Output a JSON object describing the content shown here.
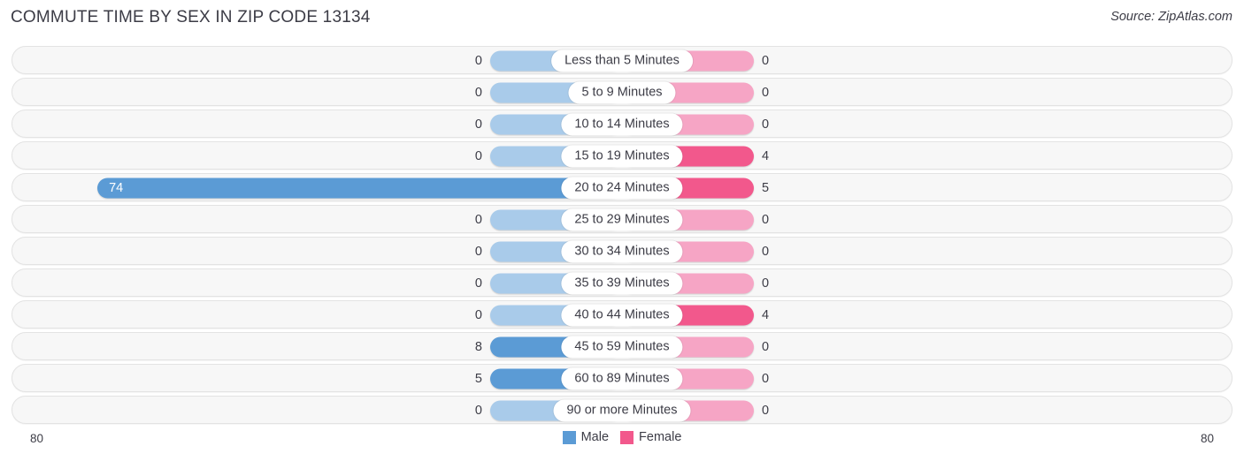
{
  "header": {
    "title": "COMMUTE TIME BY SEX IN ZIP CODE 13134",
    "source": "Source: ZipAtlas.com"
  },
  "axis": {
    "left_label": "80",
    "right_label": "80"
  },
  "legend": {
    "items": [
      {
        "label": "Male",
        "color": "#5b9bd5"
      },
      {
        "label": "Female",
        "color": "#f2588c"
      }
    ]
  },
  "colors": {
    "male_light": "#a9cbea",
    "male_strong": "#5b9bd5",
    "female_light": "#f6a5c5",
    "female_strong": "#f2588c",
    "track": "#f7f7f7",
    "text": "#3c3c46"
  },
  "chart_data": {
    "type": "bar",
    "subtype": "diverging-bidirectional",
    "title": "COMMUTE TIME BY SEX IN ZIP CODE 13134",
    "xlabel": "",
    "ylabel": "",
    "xlim": [
      80,
      80
    ],
    "axis_left_max": 80,
    "axis_right_max": 80,
    "grid": false,
    "legend_position": "bottom-center",
    "categories": [
      "Less than 5 Minutes",
      "5 to 9 Minutes",
      "10 to 14 Minutes",
      "15 to 19 Minutes",
      "20 to 24 Minutes",
      "25 to 29 Minutes",
      "30 to 34 Minutes",
      "35 to 39 Minutes",
      "40 to 44 Minutes",
      "45 to 59 Minutes",
      "60 to 89 Minutes",
      "90 or more Minutes"
    ],
    "series": [
      {
        "name": "Male",
        "side": "left",
        "color": "#5b9bd5",
        "values": [
          0,
          0,
          0,
          0,
          74,
          0,
          0,
          0,
          0,
          8,
          5,
          0
        ]
      },
      {
        "name": "Female",
        "side": "right",
        "color": "#f2588c",
        "values": [
          0,
          0,
          0,
          4,
          5,
          0,
          0,
          0,
          4,
          0,
          0,
          0
        ]
      }
    ]
  }
}
